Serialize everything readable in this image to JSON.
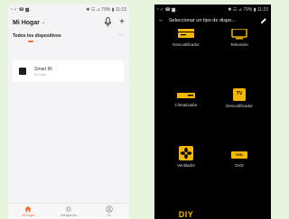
{
  "left": {
    "status": {
      "left": "ᵛ ✓ ☎ ▆ .",
      "right": "✱ ☷ ⊿ 79% ▮ 11:23"
    },
    "home_title": "Mi Hogar",
    "filter_label": "Todos los dispositivos",
    "more": "···",
    "device": {
      "name": "Smart IR",
      "status": "En línea"
    },
    "nav": [
      {
        "label": "Mi hogar",
        "icon": "home-icon"
      },
      {
        "label": "Inteligencia",
        "icon": "sun-icon"
      },
      {
        "label": "Yo",
        "icon": "profile-icon"
      }
    ],
    "colors": {
      "accent": "#ff6a33"
    }
  },
  "right": {
    "status": {
      "left": "ᵛ ✓ ☎ ▆ .",
      "right": "✱ ☷ ⊿ 79% ▮ 11:23"
    },
    "title": "Seleccionar un tipo de dispo...",
    "items": [
      {
        "label": "Descodificador"
      },
      {
        "label": "Televisión"
      },
      {
        "label": "Climatizador"
      },
      {
        "label": "Descodificador",
        "icon_text": "TV"
      },
      {
        "label": "Ventilador"
      },
      {
        "label": "DVD",
        "icon_text": "DVD"
      },
      {
        "label": "",
        "icon_text": "DIY"
      }
    ],
    "colors": {
      "icon": "#f5b800"
    }
  }
}
